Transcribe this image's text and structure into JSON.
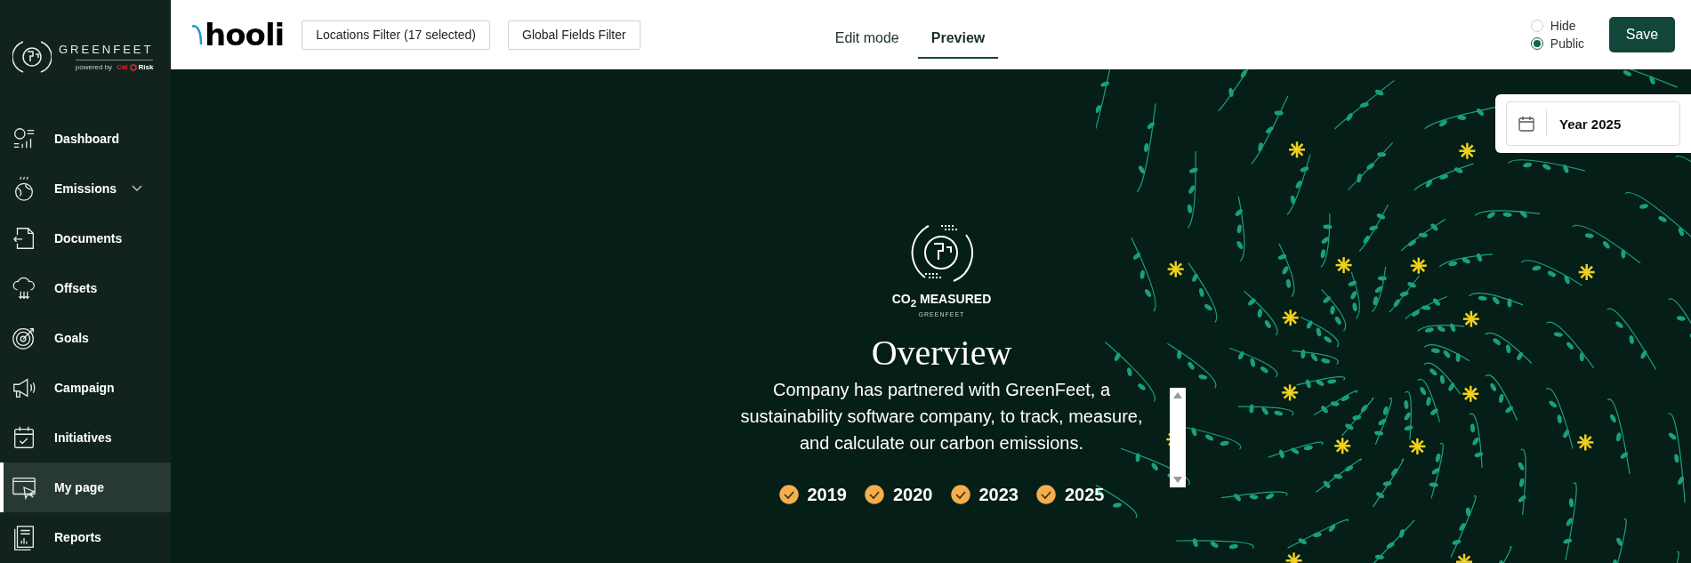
{
  "sidebar": {
    "brand": {
      "name": "GREENFEET",
      "powered_by": "powered by",
      "partner_left": "Cal",
      "partner_right": "Risk"
    },
    "items": [
      {
        "label": "Dashboard",
        "kind": "link",
        "selected": false
      },
      {
        "label": "Emissions",
        "kind": "group",
        "selected": false
      },
      {
        "label": "Documents",
        "kind": "link",
        "selected": false
      },
      {
        "label": "Offsets",
        "kind": "link",
        "selected": false
      },
      {
        "label": "Goals",
        "kind": "link",
        "selected": false
      },
      {
        "label": "Campaign",
        "kind": "link",
        "selected": false
      },
      {
        "label": "Initiatives",
        "kind": "link",
        "selected": false
      },
      {
        "label": "My page",
        "kind": "link",
        "selected": true
      },
      {
        "label": "Reports",
        "kind": "link",
        "selected": false
      }
    ]
  },
  "toolbar": {
    "logo": "hooli",
    "filters": [
      "Locations Filter (17 selected)",
      "Global Fields Filter"
    ],
    "tabs": [
      {
        "label": "Edit mode",
        "selected": false
      },
      {
        "label": "Preview",
        "selected": true
      }
    ],
    "visibility": [
      {
        "label": "Hide",
        "selected": false
      },
      {
        "label": "Public",
        "selected": true
      }
    ],
    "save": "Save"
  },
  "period": {
    "value": "Year 2025"
  },
  "hero": {
    "badge_title": "CO$_{2}$ MEASURED",
    "badge_subtitle": "GREENFEET",
    "title": "Overview",
    "text": "Company has partnered with GreenFeet, a sustainability software company, to track, measure, and calculate our carbon emissions.",
    "years": [
      {
        "label": "2019",
        "checked": true
      },
      {
        "label": "2020",
        "checked": true
      },
      {
        "label": "2023",
        "checked": true
      },
      {
        "label": "2025",
        "checked": true
      }
    ]
  }
}
